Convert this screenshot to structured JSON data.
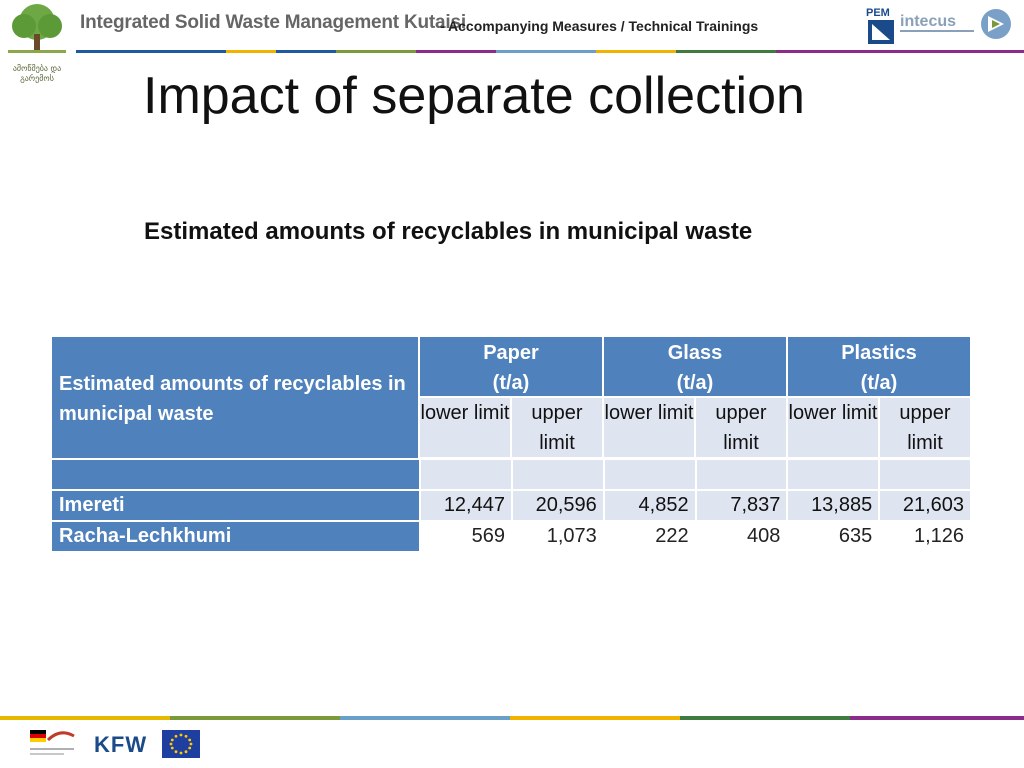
{
  "header": {
    "project_title": "Integrated Solid Waste Management Kutaisi",
    "project_subtitle": "- Accompanying Measures / Technical Trainings",
    "partner_logo_text": "ამოწმება და გარემოს",
    "pem_logo_text": "PEM",
    "intecus_logo_text": "intecus"
  },
  "slide": {
    "title": "Impact of separate collection",
    "subtitle": "Estimated amounts of recyclables in municipal waste"
  },
  "table": {
    "corner_label": "Estimated amounts of recyclables in municipal waste",
    "groups": [
      {
        "name": "Paper",
        "unit": "(t/a)"
      },
      {
        "name": "Glass",
        "unit": "(t/a)"
      },
      {
        "name": "Plastics",
        "unit": "(t/a)"
      }
    ],
    "limit_labels": {
      "lower": "lower limit",
      "upper": "upper limit"
    },
    "rows": [
      {
        "region": "Imereti",
        "values": [
          "12,447",
          "20,596",
          "4,852",
          "7,837",
          "13,885",
          "21,603"
        ]
      },
      {
        "region": "Racha-Lechkhumi",
        "values": [
          "569",
          "1,073",
          "222",
          "408",
          "635",
          "1,126"
        ]
      }
    ]
  },
  "footer": {
    "kfw_text": "KFW"
  },
  "colors": {
    "header_blue": "#4f81bd",
    "cell_light": "#dfe5f0",
    "accent_purple": "#8b2c8b",
    "accent_gold": "#f2b200"
  }
}
